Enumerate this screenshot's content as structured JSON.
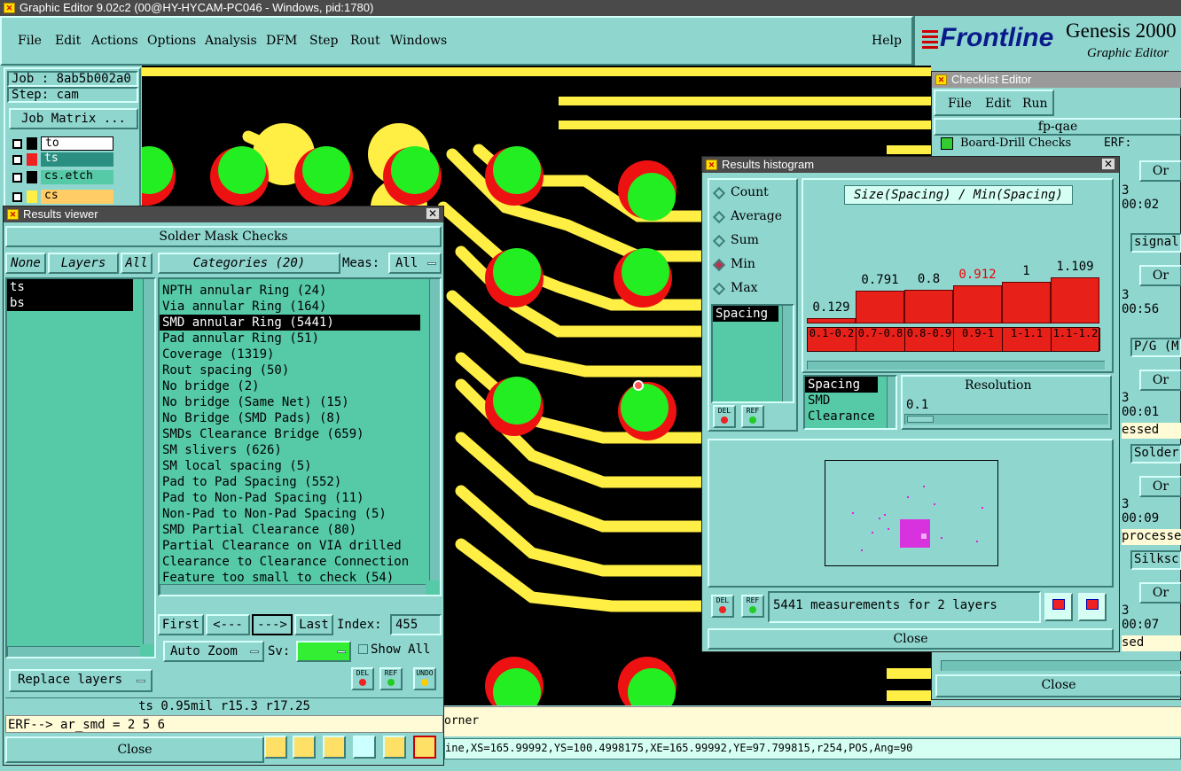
{
  "app": {
    "title": "Graphic Editor 9.02c2 (00@HY-HYCAM-PC046 - Windows, pid:1780)",
    "menu": [
      "File",
      "Edit",
      "Actions",
      "Options",
      "Analysis",
      "DFM",
      "Step",
      "Rout",
      "Windows"
    ],
    "help": "Help",
    "brand": "Frontline",
    "product": "Genesis 2000",
    "product_sub": "Graphic Editor"
  },
  "job": {
    "job_label": "Job : 8ab5b002a0",
    "step_label": "Step: cam",
    "job_matrix": "Job Matrix ...",
    "layers": [
      {
        "name": "to",
        "color": "#000000"
      },
      {
        "name": "ts",
        "color": "#ee2222"
      },
      {
        "name": "cs.etch",
        "color": "#000000"
      },
      {
        "name": "cs",
        "color": "#ffee44"
      }
    ]
  },
  "results_viewer": {
    "title": "Results viewer",
    "header": "Solder Mask Checks",
    "none_btn": "None",
    "layers_btn": "Layers",
    "all_btn": "All",
    "categories_btn": "Categories (20)",
    "meas_label": "Meas:",
    "meas_value": "All",
    "layer_list": [
      "ts",
      "bs"
    ],
    "categories": [
      "NPTH annular Ring (24)",
      "Via annular Ring (164)",
      "SMD annular Ring (5441)",
      "Pad annular Ring (51)",
      "Coverage (1319)",
      "Rout spacing (50)",
      "No bridge (2)",
      "No bridge (Same Net) (15)",
      "No Bridge (SMD Pads) (8)",
      "SMDs Clearance Bridge (659)",
      "SM slivers (626)",
      "SM local spacing (5)",
      "Pad to Pad Spacing (552)",
      "Pad to Non-Pad Spacing (11)",
      "Non-Pad to Non-Pad Spacing (5)",
      "SMD Partial Clearance (80)",
      "Partial Clearance on VIA drilled",
      "Clearance to Clearance Connection",
      "Feature too small to check (54)"
    ],
    "selected_index": 2,
    "first": "First",
    "prev": "<---",
    "next": "--->",
    "last": "Last",
    "index_label": "Index:",
    "index_value": "455",
    "auto_zoom": "Auto Zoom",
    "sv_label": "Sv:",
    "show_all": "Show All",
    "replace_layers": "Replace layers",
    "del": "DEL",
    "ref": "REF",
    "undo": "UNDO",
    "status": "ts 0.95mil  r15.3  r17.25",
    "erf": "ERF--> ar_smd = 2 5 6",
    "close": "Close"
  },
  "histogram": {
    "title": "Results histogram",
    "options": [
      "Count",
      "Average",
      "Sum",
      "Min",
      "Max"
    ],
    "selected_option": "Min",
    "left_list": [
      "Spacing"
    ],
    "chart_title": "Size(Spacing) / Min(Spacing)",
    "bins": [
      "0.1-0.2",
      "0.7-0.8",
      "0.8-0.9",
      "0.9-1",
      "1-1.1",
      "1.1-1.2"
    ],
    "values": [
      "0.129",
      "0.791",
      "0.8",
      "0.912",
      "1",
      "1.109"
    ],
    "value_nums": [
      0.129,
      0.791,
      0.8,
      0.912,
      1,
      1.109
    ],
    "highlight_index": 3,
    "attr_list": [
      "Spacing",
      "SMD",
      "Clearance"
    ],
    "resolution_label": "Resolution",
    "resolution_value": "0.1",
    "measurements": "5441 measurements for 2 layers",
    "close": "Close",
    "bar_color": "#e8201a"
  },
  "checklist": {
    "title": "Checklist Editor",
    "menu": [
      "File",
      "Edit",
      "Run"
    ],
    "name": "fp-qae",
    "row1": "Board-Drill Checks",
    "erf": "ERF:",
    "items": [
      "3",
      "00:02",
      "signal",
      "3",
      "00:56",
      "P/G (M",
      "3",
      "00:01",
      "essed",
      "Solder",
      "3",
      "00:09",
      "processed",
      "Silksc",
      "3",
      "00:07",
      "sed"
    ],
    "close": "Close"
  },
  "canvas": {
    "corner_text": "orner",
    "coords": "ine,XS=165.99992,YS=100.4998175,XE=165.99992,YE=97.799815,r254,POS,Ang=90"
  }
}
